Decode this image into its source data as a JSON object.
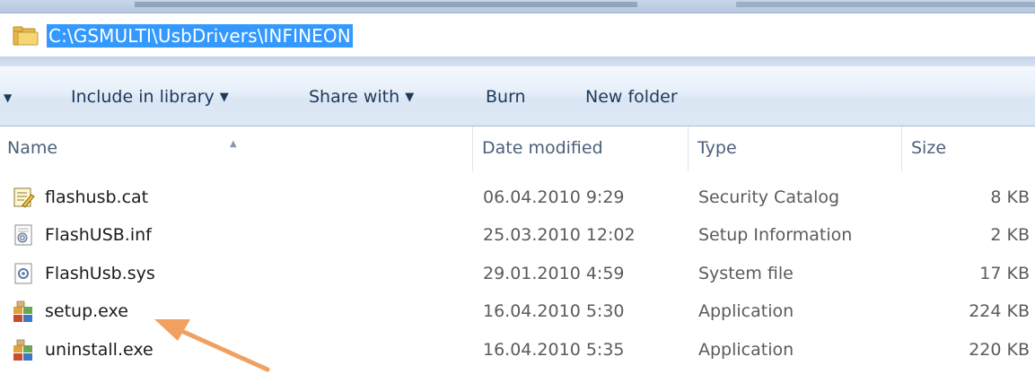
{
  "address": {
    "path": "C:\\GSMULTI\\UsbDrivers\\INFINEON"
  },
  "toolbar": {
    "include_in_library": "Include in library",
    "share_with": "Share with",
    "burn": "Burn",
    "new_folder": "New folder"
  },
  "columns": {
    "name": "Name",
    "date_modified": "Date modified",
    "type": "Type",
    "size": "Size"
  },
  "files": [
    {
      "name": "flashusb.cat",
      "date": "06.04.2010 9:29",
      "type": "Security Catalog",
      "size": "8 KB",
      "icon": "security-catalog-icon"
    },
    {
      "name": "FlashUSB.inf",
      "date": "25.03.2010 12:02",
      "type": "Setup Information",
      "size": "2 KB",
      "icon": "setup-information-icon"
    },
    {
      "name": "FlashUsb.sys",
      "date": "29.01.2010 4:59",
      "type": "System file",
      "size": "17 KB",
      "icon": "system-file-icon"
    },
    {
      "name": "setup.exe",
      "date": "16.04.2010 5:30",
      "type": "Application",
      "size": "224 KB",
      "icon": "application-icon"
    },
    {
      "name": "uninstall.exe",
      "date": "16.04.2010 5:35",
      "type": "Application",
      "size": "220 KB",
      "icon": "application-icon"
    }
  ],
  "colors": {
    "selection": "#3399ff",
    "annotation_arrow": "#f0a060"
  }
}
